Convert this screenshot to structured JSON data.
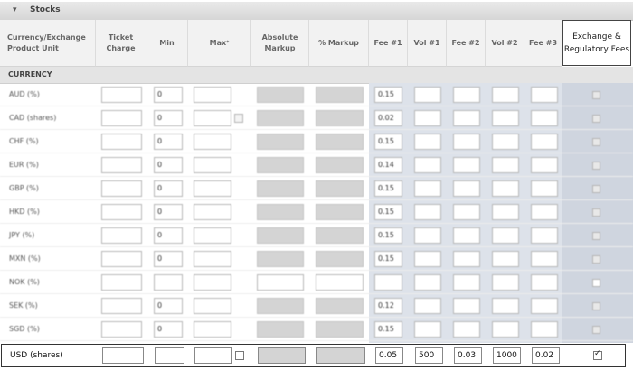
{
  "panel": {
    "title": "Stocks",
    "toggle_icon": "collapse-icon"
  },
  "columns": {
    "product_unit": "Currency/Exchange Product Unit",
    "ticket_charge": "Ticket Charge",
    "min": "Min",
    "max": "Max",
    "max_sup": "*",
    "absolute_markup": "Absolute Markup",
    "pct_markup": "% Markup",
    "fee1": "Fee #1",
    "vol1": "Vol #1",
    "fee2": "Fee #2",
    "vol2": "Vol #2",
    "fee3": "Fee #3",
    "exchange_fees": "Exchange & Regulatory Fees"
  },
  "section": {
    "title": "CURRENCY"
  },
  "rows": [
    {
      "label": "AUD (%)",
      "min": "0",
      "fee1": "0.15"
    },
    {
      "label": "CAD (shares)",
      "min": "0",
      "fee1": "0.02"
    },
    {
      "label": "CHF (%)",
      "min": "0",
      "fee1": "0.15"
    },
    {
      "label": "EUR (%)",
      "min": "0",
      "fee1": "0.14"
    },
    {
      "label": "GBP (%)",
      "min": "0",
      "fee1": "0.15"
    },
    {
      "label": "HKD (%)",
      "min": "0",
      "fee1": "0.15"
    },
    {
      "label": "JPY (%)",
      "min": "0",
      "fee1": "0.15"
    },
    {
      "label": "MXN (%)",
      "min": "0",
      "fee1": "0.15"
    },
    {
      "label": "NOK (%)",
      "min": "",
      "fee1": ""
    },
    {
      "label": "SEK (%)",
      "min": "0",
      "fee1": "0.12"
    },
    {
      "label": "SGD (%)",
      "min": "0",
      "fee1": "0.15"
    }
  ],
  "usd": {
    "label": "USD (shares)",
    "ticket": "",
    "min": "",
    "max": "",
    "fee1": "0.05",
    "vol1": "500",
    "fee2": "0.03",
    "vol2": "1000",
    "fee3": "0.02",
    "exchange_checked": true
  }
}
